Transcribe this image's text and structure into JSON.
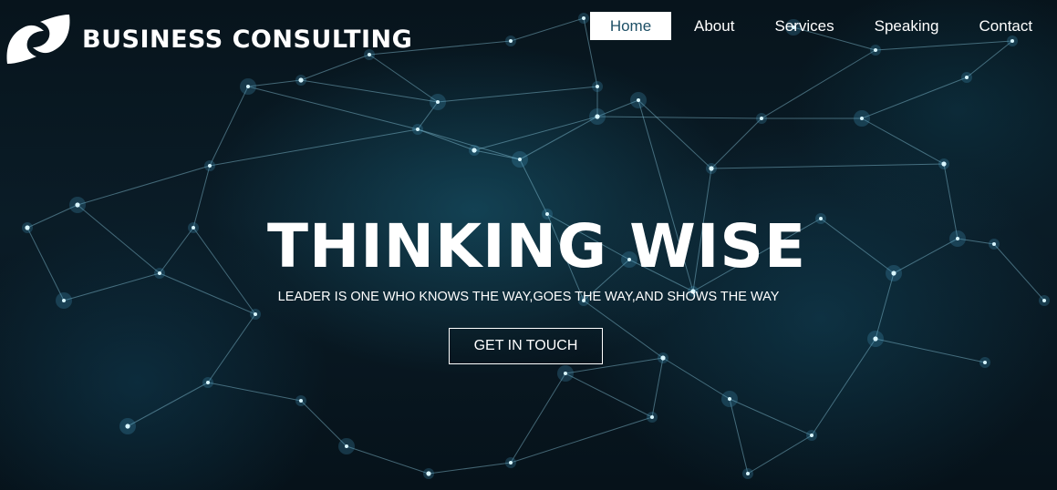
{
  "brand": {
    "name": "BUSINESS CONSULTING",
    "logo_icon": "swirl-arrows-logo-icon"
  },
  "nav": {
    "items": [
      {
        "label": "Home",
        "active": true
      },
      {
        "label": "About",
        "active": false
      },
      {
        "label": "Services",
        "active": false
      },
      {
        "label": "Speaking",
        "active": false
      },
      {
        "label": "Contact",
        "active": false
      }
    ]
  },
  "hero": {
    "headline": "THINKING WISE",
    "tagline": "LEADER IS ONE WHO KNOWS THE WAY,GOES THE WAY,AND SHOWS THE WAY",
    "cta_label": "GET IN TOUCH",
    "background": "network-nodes-background"
  },
  "colors": {
    "background": "#07141c",
    "accent": "#1d4f66",
    "text": "#ffffff",
    "network_line": "#96d7eb"
  }
}
